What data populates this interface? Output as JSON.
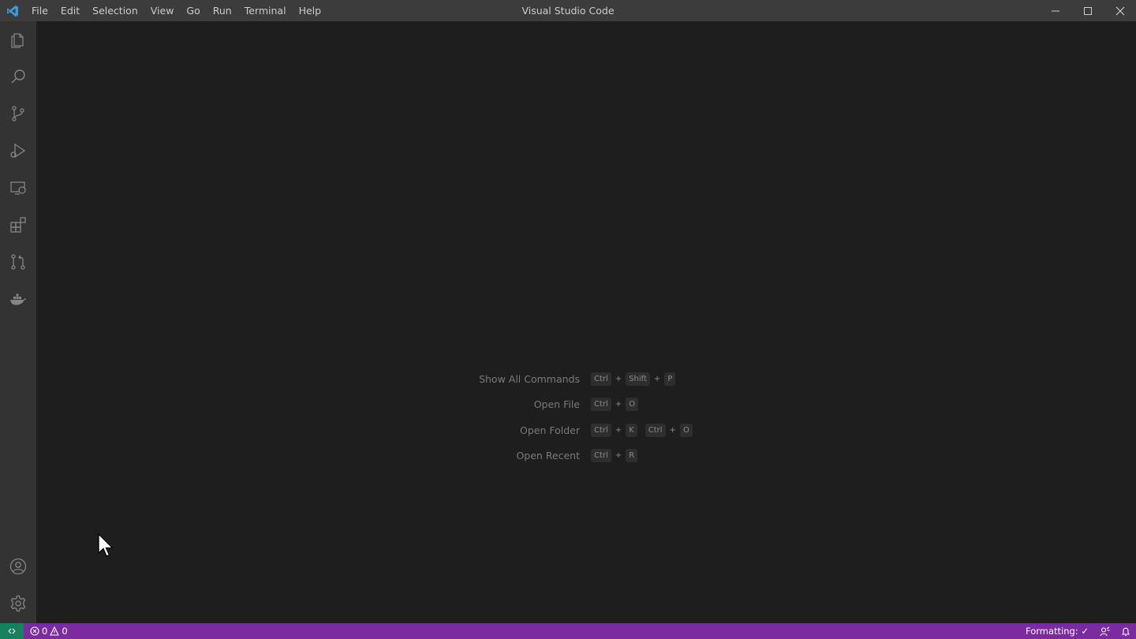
{
  "titlebar": {
    "menu": [
      "File",
      "Edit",
      "Selection",
      "View",
      "Go",
      "Run",
      "Terminal",
      "Help"
    ],
    "title": "Visual Studio Code"
  },
  "activitybar": {
    "items": [
      {
        "name": "explorer",
        "icon": "files-icon"
      },
      {
        "name": "search",
        "icon": "search-icon"
      },
      {
        "name": "source-control",
        "icon": "source-control-icon"
      },
      {
        "name": "run-and-debug",
        "icon": "run-debug-icon"
      },
      {
        "name": "remote-explorer",
        "icon": "remote-explorer-icon"
      },
      {
        "name": "extensions",
        "icon": "extensions-icon"
      },
      {
        "name": "pull-requests",
        "icon": "pull-request-icon"
      },
      {
        "name": "docker",
        "icon": "docker-icon"
      }
    ],
    "bottom": [
      {
        "name": "accounts",
        "icon": "account-icon"
      },
      {
        "name": "manage",
        "icon": "gear-icon"
      }
    ]
  },
  "editor": {
    "shortcuts": [
      {
        "label": "Show All Commands",
        "k1": "Ctrl",
        "k2": "Shift",
        "k3": "P"
      },
      {
        "label": "Open File",
        "k1": "Ctrl",
        "k2": "O"
      },
      {
        "label": "Open Folder",
        "k1": "Ctrl",
        "k2": "K",
        "k3": "Ctrl",
        "k4": "O"
      },
      {
        "label": "Open Recent",
        "k1": "Ctrl",
        "k2": "R"
      }
    ]
  },
  "statusbar": {
    "errors": "0",
    "warnings": "0",
    "formatting": "Formatting: ✓",
    "colors": {
      "background": "#7c2aa0",
      "remote": "#16825d"
    }
  }
}
